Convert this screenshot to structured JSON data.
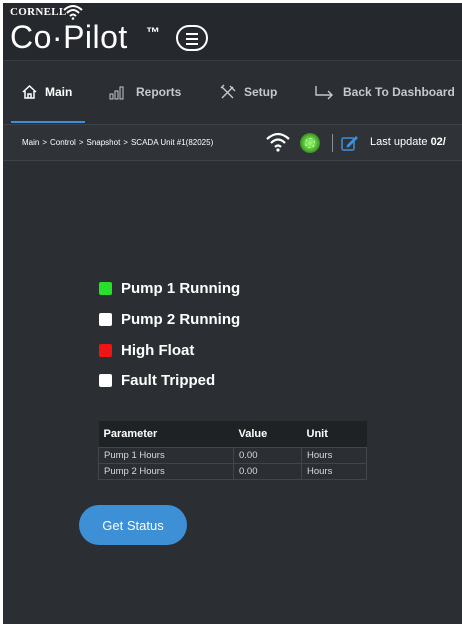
{
  "brand": {
    "top": "CORNELL",
    "name": "Co·Pilot",
    "tm": "™"
  },
  "nav": {
    "items": [
      {
        "label": "Main",
        "icon": "home-icon",
        "active": true
      },
      {
        "label": "Reports",
        "icon": "bar-chart-icon",
        "active": false
      },
      {
        "label": "Setup",
        "icon": "tools-icon",
        "active": false
      },
      {
        "label": "Back To Dashboard",
        "icon": "back-arrow-icon",
        "active": false
      }
    ]
  },
  "breadcrumb": [
    "Main",
    "Control",
    "Snapshot",
    "SCADA Unit #1(82025)"
  ],
  "breadcrumb_separator": ">",
  "status_bar": {
    "last_update_label": "Last update",
    "last_update_value": "02/"
  },
  "status": [
    {
      "label": "Pump 1 Running",
      "color": "#27e02a"
    },
    {
      "label": "Pump 2 Running",
      "color": "#ffffff"
    },
    {
      "label": "High Float",
      "color": "#f01414"
    },
    {
      "label": "Fault Tripped",
      "color": "#ffffff"
    }
  ],
  "table": {
    "headers": [
      "Parameter",
      "Value",
      "Unit"
    ],
    "rows": [
      [
        "Pump 1 Hours",
        "0.00",
        "Hours"
      ],
      [
        "Pump 2 Hours",
        "0.00",
        "Hours"
      ]
    ]
  },
  "actions": {
    "get_status_label": "Get Status"
  },
  "colors": {
    "accent": "#3d8fd6",
    "background": "#2b2f33",
    "header": "#25292d"
  }
}
